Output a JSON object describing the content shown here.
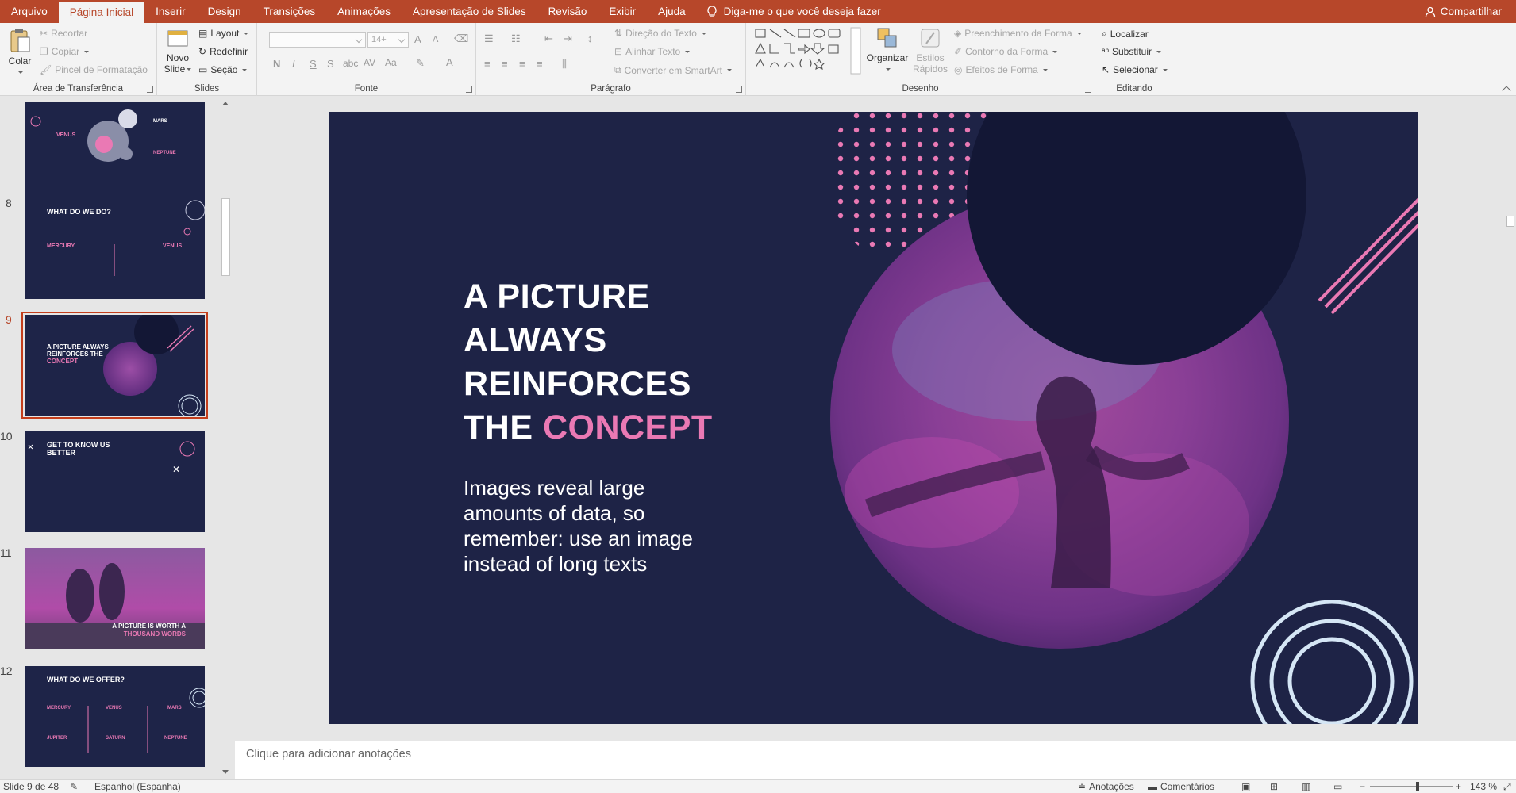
{
  "menubar": {
    "tabs": [
      "Arquivo",
      "Página Inicial",
      "Inserir",
      "Design",
      "Transições",
      "Animações",
      "Apresentação de Slides",
      "Revisão",
      "Exibir",
      "Ajuda"
    ],
    "active_index": 1,
    "tell_me": "Diga-me o que você deseja fazer",
    "share": "Compartilhar"
  },
  "ribbon": {
    "clipboard": {
      "label": "Área de Transferência",
      "paste": "Colar",
      "cut": "Recortar",
      "copy": "Copiar",
      "format_painter": "Pincel de Formatação"
    },
    "slides": {
      "label": "Slides",
      "new_slide_1": "Novo",
      "new_slide_2": "Slide",
      "layout": "Layout",
      "reset": "Redefinir",
      "section": "Seção"
    },
    "font": {
      "label": "Fonte",
      "size": "14+",
      "grow": "A",
      "shrink": "A",
      "bold": "N",
      "italic": "I",
      "underline": "S",
      "shadow": "S",
      "spacing": "AV",
      "case": "Aa",
      "color": "A"
    },
    "paragraph": {
      "label": "Parágrafo",
      "text_direction": "Direção do Texto",
      "align_text": "Alinhar Texto",
      "convert_smartart": "Converter em SmartArt"
    },
    "drawing": {
      "label": "Desenho",
      "arrange": "Organizar",
      "quick_styles_1": "Estilos",
      "quick_styles_2": "Rápidos",
      "shape_fill": "Preenchimento da Forma",
      "shape_outline": "Contorno da Forma",
      "shape_effects": "Efeitos de Forma"
    },
    "editing": {
      "label": "Editando",
      "find": "Localizar",
      "replace": "Substituir",
      "select": "Selecionar"
    }
  },
  "thumbnails": [
    {
      "num": "",
      "title": "",
      "planets": {
        "a": "VENUS",
        "b": "MARS",
        "c": "NEPTUNE"
      }
    },
    {
      "num": "8",
      "title": "WHAT DO WE DO?",
      "cols": [
        "MERCURY",
        "VENUS"
      ]
    },
    {
      "num": "9",
      "title_white": "A PICTURE ALWAYS REINFORCES THE",
      "title_pink": "CONCEPT",
      "selected": true
    },
    {
      "num": "10",
      "title": "GET TO KNOW US BETTER"
    },
    {
      "num": "11",
      "title_white": "A PICTURE IS WORTH A",
      "title_pink": "THOUSAND WORDS"
    },
    {
      "num": "12",
      "title": "WHAT DO WE OFFER?",
      "row1": [
        "MERCURY",
        "VENUS",
        "MARS"
      ],
      "row2": [
        "JUPITER",
        "SATURN",
        "NEPTUNE"
      ]
    }
  ],
  "slide": {
    "headline_lines": [
      "A PICTURE",
      "ALWAYS",
      "REINFORCES",
      "THE"
    ],
    "headline_accent": "CONCEPT",
    "body": "Images reveal large amounts of data, so remember: use an image instead of long texts",
    "colors": {
      "background": "#1e2346",
      "accent": "#ea79b4",
      "dark_circle": "#131735",
      "ring": "#d5e6f5"
    }
  },
  "notes": {
    "placeholder": "Clique para adicionar anotações"
  },
  "status": {
    "slide_info": "Slide 9 de 48",
    "language": "Espanhol (Espanha)",
    "notes": "Anotações",
    "comments": "Comentários",
    "zoom": "143 %"
  }
}
